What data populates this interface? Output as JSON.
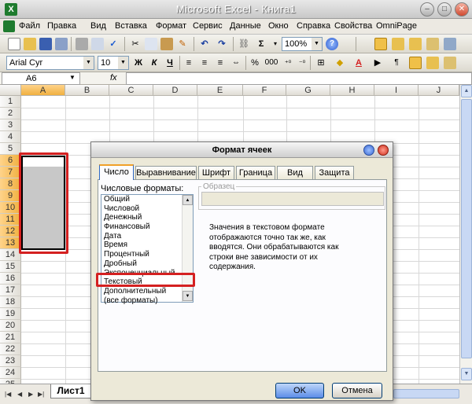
{
  "window": {
    "title": "Microsoft Excel - Книга1",
    "app_icon": "excel-icon"
  },
  "menu": [
    "Файл",
    "Правка",
    "Вид",
    "Вставка",
    "Формат",
    "Сервис",
    "Данные",
    "Окно",
    "Справка",
    "Свойства",
    "OmniPage"
  ],
  "toolbar": {
    "zoom": "100%"
  },
  "format_toolbar": {
    "font": "Arial Cyr",
    "size": "10",
    "bold": "Ж",
    "italic": "К",
    "underline": "Ч",
    "percent": "%",
    "thousands": "000",
    "font_color_letter": "A"
  },
  "formula_bar": {
    "cell_ref": "A6",
    "fx": "fx"
  },
  "columns": [
    "A",
    "B",
    "C",
    "D",
    "E",
    "F",
    "G",
    "H",
    "I",
    "J"
  ],
  "rows": [
    "1",
    "2",
    "3",
    "4",
    "5",
    "6",
    "7",
    "8",
    "9",
    "10",
    "11",
    "12",
    "13",
    "14",
    "15",
    "16",
    "17",
    "18",
    "19",
    "20",
    "21",
    "22",
    "23",
    "24",
    "25"
  ],
  "sheet": {
    "tab": "Лист1"
  },
  "dialog": {
    "title": "Формат ячеек",
    "tabs": [
      "Число",
      "Выравнивание",
      "Шрифт",
      "Граница",
      "Вид",
      "Защита"
    ],
    "active_tab": "Число",
    "formats_label": "Числовые форматы:",
    "formats": [
      "Общий",
      "Числовой",
      "Денежный",
      "Финансовый",
      "Дата",
      "Время",
      "Процентный",
      "Дробный",
      "Экспоненциальный",
      "Текстовый",
      "Дополнительный",
      "(все форматы)"
    ],
    "selected_format": "Текстовый",
    "sample_label": "Образец",
    "description": "Значения в текстовом формате\nотображаются точно так же, как\nвводятся. Они обрабатываются как\nстроки вне зависимости от их\nсодержания.",
    "ok": "OK",
    "cancel": "Отмена"
  },
  "colors": {
    "highlight_red": "#d42020",
    "excel_green": "#1e7b2e"
  }
}
